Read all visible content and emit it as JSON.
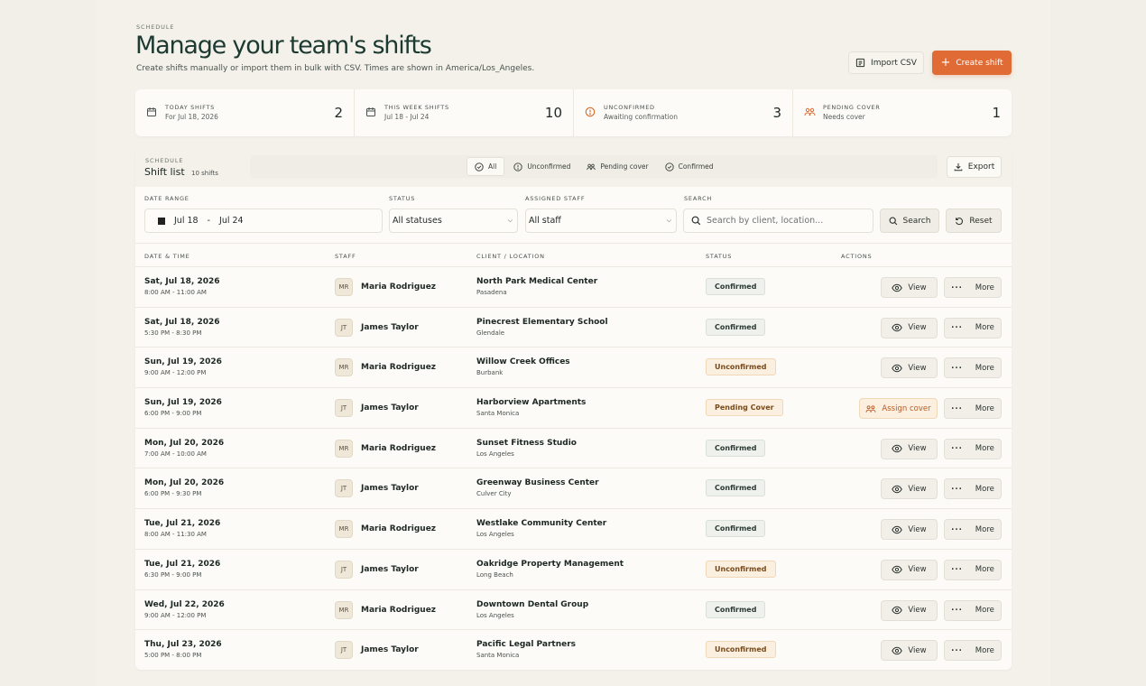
{
  "header": {
    "eyebrow": "SCHEDULE",
    "title": "Manage your team's shifts",
    "subtitle": "Create shifts manually or import them in bulk with CSV. Times are shown in America/Los_Angeles.",
    "import_label": "Import CSV",
    "create_label": "Create shift"
  },
  "stats": [
    {
      "label": "TODAY SHIFTS",
      "sub": "For Jul 18, 2026",
      "value": "2"
    },
    {
      "label": "THIS WEEK SHIFTS",
      "sub": "Jul 18 - Jul 24",
      "value": "10"
    },
    {
      "label": "UNCONFIRMED",
      "sub": "Awaiting confirmation",
      "value": "3"
    },
    {
      "label": "PENDING COVER",
      "sub": "Needs cover",
      "value": "1"
    }
  ],
  "list": {
    "eyebrow": "SCHEDULE",
    "title": "Shift list",
    "count": "10 shifts",
    "chips": [
      "All",
      "Unconfirmed",
      "Pending cover",
      "Confirmed"
    ],
    "export_label": "Export"
  },
  "filters": {
    "date_label": "DATE RANGE",
    "date_from": "Jul 18",
    "date_sep": "-",
    "date_to": "Jul 24",
    "status_label": "STATUS",
    "status_value": "All statuses",
    "staff_label": "ASSIGNED STAFF",
    "staff_value": "All staff",
    "search_label": "SEARCH",
    "search_placeholder": "Search by client, location...",
    "search_button": "Search",
    "reset_button": "Reset"
  },
  "table": {
    "headers": [
      "DATE & TIME",
      "STAFF",
      "CLIENT / LOCATION",
      "STATUS",
      "ACTIONS"
    ],
    "view_label": "View",
    "more_label": "More",
    "assign_label": "Assign cover",
    "rows": [
      {
        "date": "Sat, Jul 18, 2026",
        "time": "8:00 AM - 11:00 AM",
        "initials": "MR",
        "staff": "Maria Rodriguez",
        "client": "North Park Medical Center",
        "location": "Pasadena",
        "status": "Confirmed"
      },
      {
        "date": "Sat, Jul 18, 2026",
        "time": "5:30 PM - 8:30 PM",
        "initials": "JT",
        "staff": "James Taylor",
        "client": "Pinecrest Elementary School",
        "location": "Glendale",
        "status": "Confirmed"
      },
      {
        "date": "Sun, Jul 19, 2026",
        "time": "9:00 AM - 12:00 PM",
        "initials": "MR",
        "staff": "Maria Rodriguez",
        "client": "Willow Creek Offices",
        "location": "Burbank",
        "status": "Unconfirmed"
      },
      {
        "date": "Sun, Jul 19, 2026",
        "time": "6:00 PM - 9:00 PM",
        "initials": "JT",
        "staff": "James Taylor",
        "client": "Harborview Apartments",
        "location": "Santa Monica",
        "status": "Pending Cover"
      },
      {
        "date": "Mon, Jul 20, 2026",
        "time": "7:00 AM - 10:00 AM",
        "initials": "MR",
        "staff": "Maria Rodriguez",
        "client": "Sunset Fitness Studio",
        "location": "Los Angeles",
        "status": "Confirmed"
      },
      {
        "date": "Mon, Jul 20, 2026",
        "time": "6:00 PM - 9:30 PM",
        "initials": "JT",
        "staff": "James Taylor",
        "client": "Greenway Business Center",
        "location": "Culver City",
        "status": "Confirmed"
      },
      {
        "date": "Tue, Jul 21, 2026",
        "time": "8:00 AM - 11:30 AM",
        "initials": "MR",
        "staff": "Maria Rodriguez",
        "client": "Westlake Community Center",
        "location": "Los Angeles",
        "status": "Confirmed"
      },
      {
        "date": "Tue, Jul 21, 2026",
        "time": "6:30 PM - 9:00 PM",
        "initials": "JT",
        "staff": "James Taylor",
        "client": "Oakridge Property Management",
        "location": "Long Beach",
        "status": "Unconfirmed"
      },
      {
        "date": "Wed, Jul 22, 2026",
        "time": "9:00 AM - 12:00 PM",
        "initials": "MR",
        "staff": "Maria Rodriguez",
        "client": "Downtown Dental Group",
        "location": "Los Angeles",
        "status": "Confirmed"
      },
      {
        "date": "Thu, Jul 23, 2026",
        "time": "5:00 PM - 8:00 PM",
        "initials": "JT",
        "staff": "James Taylor",
        "client": "Pacific Legal Partners",
        "location": "Santa Monica",
        "status": "Unconfirmed"
      }
    ]
  },
  "colors": {
    "accent": "#e06b35",
    "background": "#f3f1ea",
    "card": "#fcfbf7",
    "title": "#1c3a32"
  }
}
